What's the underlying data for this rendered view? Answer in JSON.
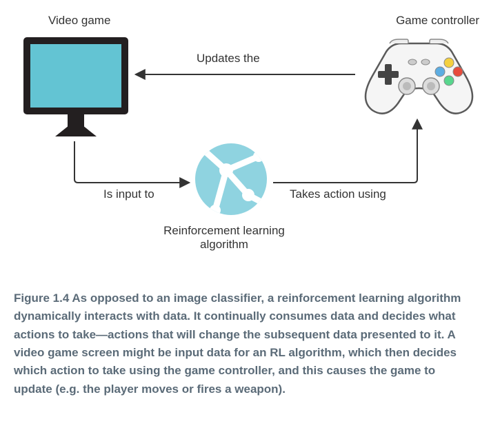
{
  "labels": {
    "videoGame": "Video game",
    "gameController": "Game controller",
    "updatesThe": "Updates the",
    "isInputTo": "Is input to",
    "takesActionUsing": "Takes action using",
    "rlAlgorithmLine1": "Reinforcement learning",
    "rlAlgorithmLine2": "algorithm"
  },
  "caption": {
    "prefix": "Figure 1.4",
    "text": " As opposed to an image classifier, a reinforcement learning algorithm dynamically interacts with data. It continually consumes data and decides what actions to take—actions that will change the subsequent data presented to it. A video game screen might be input data for an RL algorithm, which then decides which action to take using the game controller, and this causes the game to update (e.g. the player moves or fires a weapon)."
  }
}
